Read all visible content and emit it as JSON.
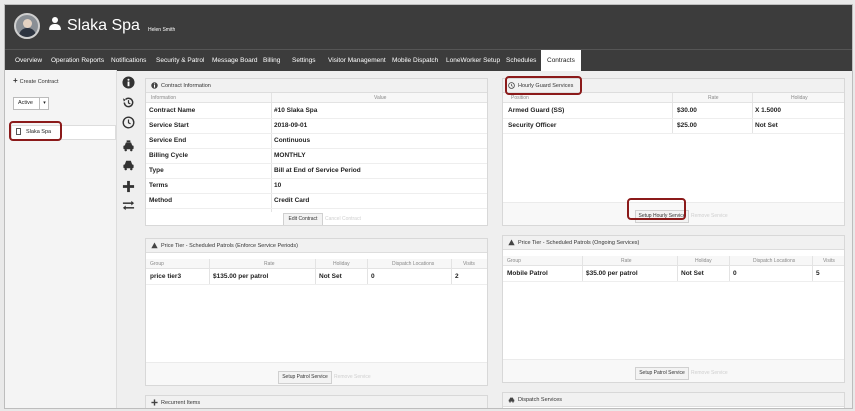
{
  "header": {
    "client_name": "Slaka Spa",
    "client_sub": "Helen Smith"
  },
  "nav": {
    "tabs": [
      "Overview",
      "Operation Reports",
      "Notifications",
      "Security & Patrol",
      "Message Board",
      "Billing",
      "Settings",
      "Visitor Management",
      "Mobile Dispatch",
      "LoneWorker Setup",
      "Schedules",
      "Contracts"
    ],
    "active": "Contracts"
  },
  "sidebar": {
    "create_label": "Create Contract",
    "filter_value": "Active",
    "contracts": [
      "Slaka Spa"
    ]
  },
  "contract_info": {
    "title": "Contract Information",
    "col_info": "Information",
    "col_value": "Value",
    "rows": [
      {
        "label": "Contract Name",
        "value": "#10 Slaka Spa"
      },
      {
        "label": "Service Start",
        "value": "2018-09-01"
      },
      {
        "label": "Service End",
        "value": "Continuous"
      },
      {
        "label": "Billing Cycle",
        "value": "MONTHLY"
      },
      {
        "label": "Type",
        "value": "Bill at End of Service Period"
      },
      {
        "label": "Terms",
        "value": "10"
      },
      {
        "label": "Method",
        "value": "Credit Card"
      }
    ],
    "edit_button": "Edit Contract",
    "ghost_button": "Cancel Contract"
  },
  "hourly": {
    "title": "Hourly Guard Services",
    "col_position": "Position",
    "col_rate": "Rate",
    "col_holiday": "Holiday",
    "rows": [
      {
        "position": "Armed Guard (SS)",
        "rate": "$30.00",
        "holiday": "X 1.5000"
      },
      {
        "position": "Security Officer",
        "rate": "$25.00",
        "holiday": "Not Set"
      }
    ],
    "setup_button": "Setup Hourly Service",
    "ghost_button": "Remove Service"
  },
  "tier_enforce": {
    "title": "Price Tier - Scheduled Patrols (Enforce Service Periods)",
    "cols": [
      "Group",
      "Rate",
      "Holiday",
      "Dispatch Locations",
      "Visits"
    ],
    "rows": [
      {
        "group": "price tier3",
        "rate": "$135.00 per patrol",
        "holiday": "Not Set",
        "locations": "0",
        "visits": "2"
      }
    ],
    "setup_button": "Setup Patrol Service",
    "ghost_button": "Remove Service"
  },
  "tier_ongoing": {
    "title": "Price Tier - Scheduled Patrols (Ongoing Services)",
    "cols": [
      "Group",
      "Rate",
      "Holiday",
      "Dispatch Locations",
      "Visits"
    ],
    "rows": [
      {
        "group": "Mobile Patrol",
        "rate": "$35.00 per patrol",
        "holiday": "Not Set",
        "locations": "0",
        "visits": "5"
      }
    ],
    "setup_button": "Setup Patrol Service",
    "ghost_button": "Remove Service"
  },
  "recurrent": {
    "title": "Recurrent Items"
  },
  "dispatch": {
    "title": "Dispatch Services"
  },
  "colors": {
    "header_bg": "#3c3c3c",
    "highlight": "#8b1a1a"
  }
}
